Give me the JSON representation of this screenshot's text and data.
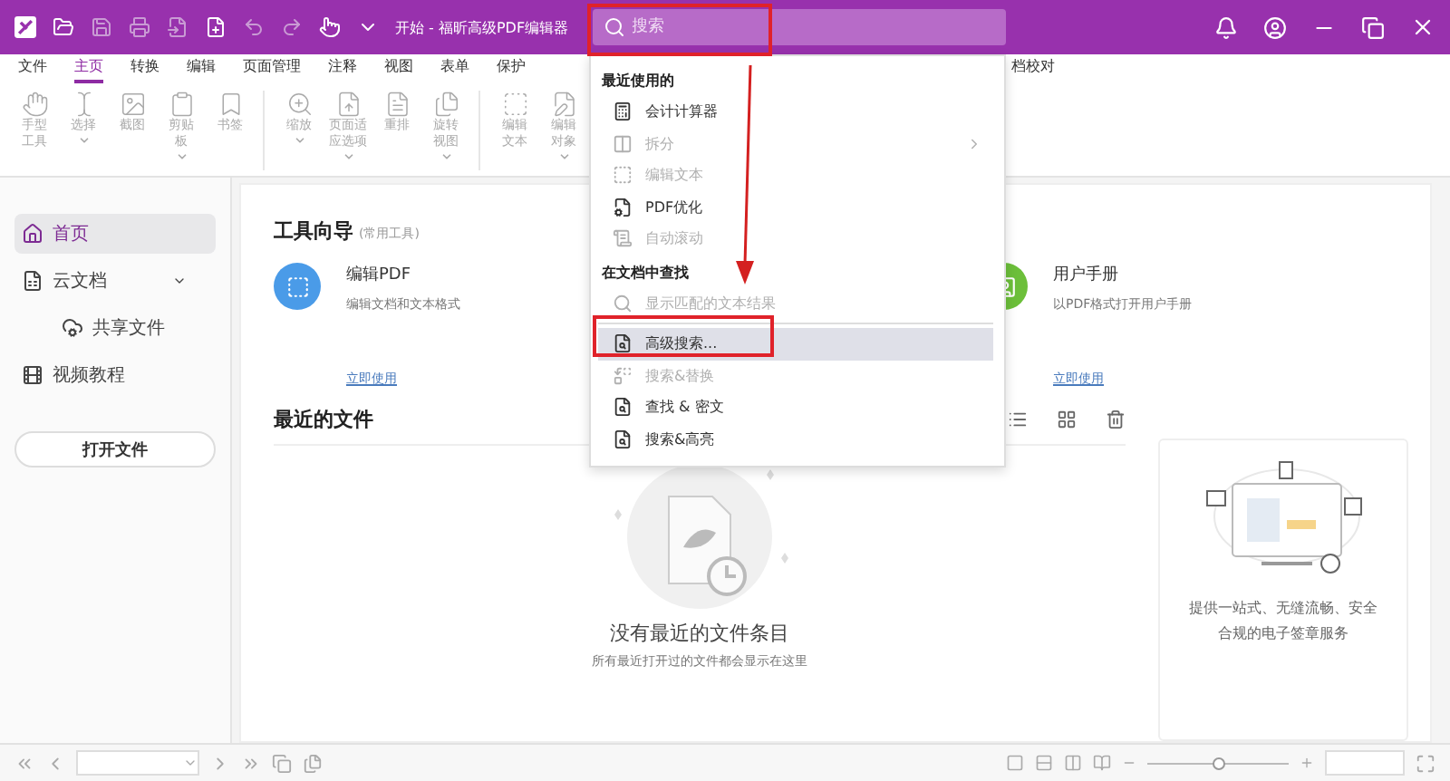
{
  "window": {
    "title": "开始 - 福昕高级PDF编辑器"
  },
  "search": {
    "placeholder": "搜索"
  },
  "tabs": [
    {
      "label": "文件",
      "selected": false
    },
    {
      "label": "主页",
      "selected": true
    },
    {
      "label": "转换",
      "selected": false
    },
    {
      "label": "编辑",
      "selected": false
    },
    {
      "label": "页面管理",
      "selected": false
    },
    {
      "label": "注释",
      "selected": false
    },
    {
      "label": "视图",
      "selected": false
    },
    {
      "label": "表单",
      "selected": false
    },
    {
      "label": "保护",
      "selected": false
    },
    {
      "label": "档校对",
      "selected": false
    }
  ],
  "toolbar": {
    "groups": [
      {
        "tools": [
          {
            "lines": [
              "手型",
              "工具"
            ],
            "has_menu": false
          },
          {
            "lines": [
              "选择"
            ],
            "has_menu": true
          },
          {
            "lines": [
              "截图"
            ],
            "has_menu": false
          },
          {
            "lines": [
              "剪贴",
              "板"
            ],
            "has_menu": true
          },
          {
            "lines": [
              "书签"
            ],
            "has_menu": false
          }
        ]
      },
      {
        "tools": [
          {
            "lines": [
              "缩放"
            ],
            "has_menu": true
          },
          {
            "lines": [
              "页面适",
              "应选项"
            ],
            "has_menu": true
          },
          {
            "lines": [
              "重排"
            ],
            "has_menu": false
          },
          {
            "lines": [
              "旋转",
              "视图"
            ],
            "has_menu": true
          }
        ]
      },
      {
        "tools": [
          {
            "lines": [
              "编辑",
              "文本"
            ],
            "has_menu": false
          },
          {
            "lines": [
              "编辑",
              "对象"
            ],
            "has_menu": true
          }
        ]
      }
    ]
  },
  "sidebar": {
    "items": [
      {
        "label": "首页",
        "selected": true
      },
      {
        "label": "云文档",
        "selected": false,
        "expanded": true,
        "children": [
          {
            "label": "共享文件",
            "selected": false
          }
        ]
      },
      {
        "label": "视频教程",
        "selected": false
      }
    ],
    "open_button": "打开文件"
  },
  "tool_guide": {
    "title": "工具向导",
    "subtitle": "(常用工具)",
    "cards": [
      {
        "title": "编辑PDF",
        "description": "编辑文档和文本格式",
        "link": "立即使用",
        "color": "#4a9be8"
      },
      {
        "title": "用户手册",
        "description": "以PDF格式打开用户手册",
        "link": "立即使用",
        "color": "#6cbf3a"
      }
    ]
  },
  "recent": {
    "title": "最近的文件",
    "empty_title": "没有最近的文件条目",
    "empty_text": "所有最近打开过的文件都会显示在这里"
  },
  "promo": {
    "text": "提供一站式、无缝流畅、安全合规的电子签章服务"
  },
  "dropdown": {
    "sections": [
      {
        "header": "最近使用的",
        "items": [
          {
            "label": "会计计算器",
            "disabled": false,
            "selected": false,
            "has_submenu": false
          },
          {
            "label": "拆分",
            "disabled": true,
            "selected": false,
            "has_submenu": true
          },
          {
            "label": "编辑文本",
            "disabled": true,
            "selected": false,
            "has_submenu": false
          },
          {
            "label": "PDF优化",
            "disabled": false,
            "selected": false,
            "has_submenu": false
          },
          {
            "label": "自动滚动",
            "disabled": true,
            "selected": false,
            "has_submenu": false
          }
        ]
      },
      {
        "header": "在文档中查找",
        "items": [
          {
            "label": "显示匹配的文本结果",
            "disabled": true,
            "selected": false,
            "has_submenu": false
          },
          {
            "label": "高级搜索...",
            "disabled": false,
            "selected": true,
            "has_submenu": false
          },
          {
            "label": "搜索&替换",
            "disabled": true,
            "selected": false,
            "has_submenu": false
          },
          {
            "label": "查找 & 密文",
            "disabled": false,
            "selected": false,
            "has_submenu": false
          },
          {
            "label": "搜索&高亮",
            "disabled": false,
            "selected": false,
            "has_submenu": false
          }
        ]
      }
    ]
  },
  "status_bar": {
    "zoom": {
      "level": 0.5
    }
  }
}
